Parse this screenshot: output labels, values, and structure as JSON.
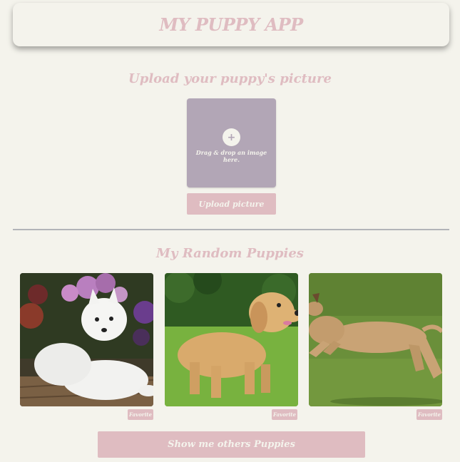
{
  "header": {
    "title": "MY PUPPY APP"
  },
  "upload": {
    "title": "Upload your puppy's picture",
    "plus_icon": "+",
    "drop_text": "Drag & drop an image here.",
    "button_label": "Upload picture"
  },
  "random": {
    "title": "My Random Puppies",
    "cards": [
      {
        "image": "white-spitz-dog-photo",
        "favorite_label": "Favorite"
      },
      {
        "image": "golden-retriever-photo",
        "favorite_label": "Favorite"
      },
      {
        "image": "running-greyhound-photo",
        "favorite_label": "Favorite"
      }
    ],
    "more_button_label": "Show me others Puppies"
  },
  "colors": {
    "background": "#f4f3ec",
    "accent_pink": "#dfbcc1",
    "dropzone": "#b2a6b6",
    "divider": "#b2b4b8"
  }
}
